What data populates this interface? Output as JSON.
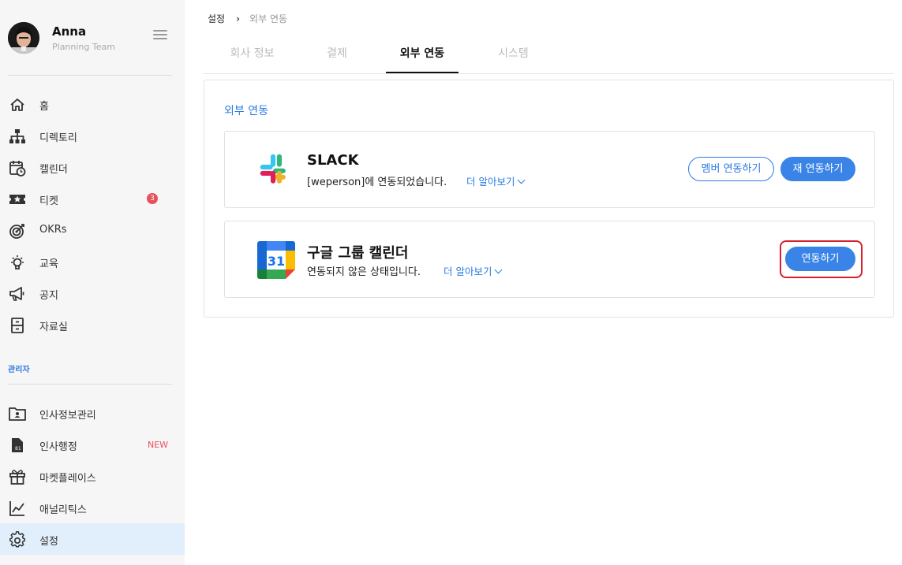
{
  "user": {
    "name": "Anna",
    "team": "Planning Team"
  },
  "sidebar": {
    "items": [
      {
        "label": "홈",
        "icon": "home-icon"
      },
      {
        "label": "디렉토리",
        "icon": "org-chart-icon"
      },
      {
        "label": "캘린더",
        "icon": "calendar-clock-icon"
      },
      {
        "label": "티켓",
        "icon": "ticket-star-icon",
        "badge": "3"
      },
      {
        "label": "OKRs",
        "icon": "target-icon"
      },
      {
        "label": "교육",
        "icon": "lightbulb-icon"
      },
      {
        "label": "공지",
        "icon": "megaphone-icon"
      },
      {
        "label": "자료실",
        "icon": "file-cabinet-icon"
      }
    ],
    "admin_label": "관리자",
    "admin_items": [
      {
        "label": "인사정보관리",
        "icon": "id-folder-icon"
      },
      {
        "label": "인사행정",
        "icon": "document-icon",
        "tag": "NEW"
      },
      {
        "label": "마켓플레이스",
        "icon": "gift-icon"
      },
      {
        "label": "애널리틱스",
        "icon": "line-chart-icon"
      },
      {
        "label": "설정",
        "icon": "gear-icon",
        "active": true
      }
    ]
  },
  "breadcrumb": {
    "root": "설정",
    "current": "외부 연동"
  },
  "tabs": [
    {
      "label": "회사 정보"
    },
    {
      "label": "결제"
    },
    {
      "label": "외부 연동",
      "active": true
    },
    {
      "label": "시스템"
    }
  ],
  "panel": {
    "title": "외부 연동",
    "integrations": [
      {
        "name": "SLACK",
        "icon": "slack-logo-icon",
        "status": "[weperson]에 연동되었습니다.",
        "learn_more": "더 알아보기",
        "buttons": [
          "멤버 연동하기",
          "재 연동하기"
        ]
      },
      {
        "name": "구글 그룹 캘린더",
        "icon": "google-calendar-logo-icon",
        "logo_text": "31",
        "status": "연동되지 않은 상태입니다.",
        "learn_more": "더 알아보기",
        "buttons": [
          "연동하기"
        ]
      }
    ]
  },
  "colors": {
    "accent": "#2b7be4",
    "active_bg": "#e1eefb",
    "alert": "#e8505b",
    "highlight": "#d91f2a"
  }
}
